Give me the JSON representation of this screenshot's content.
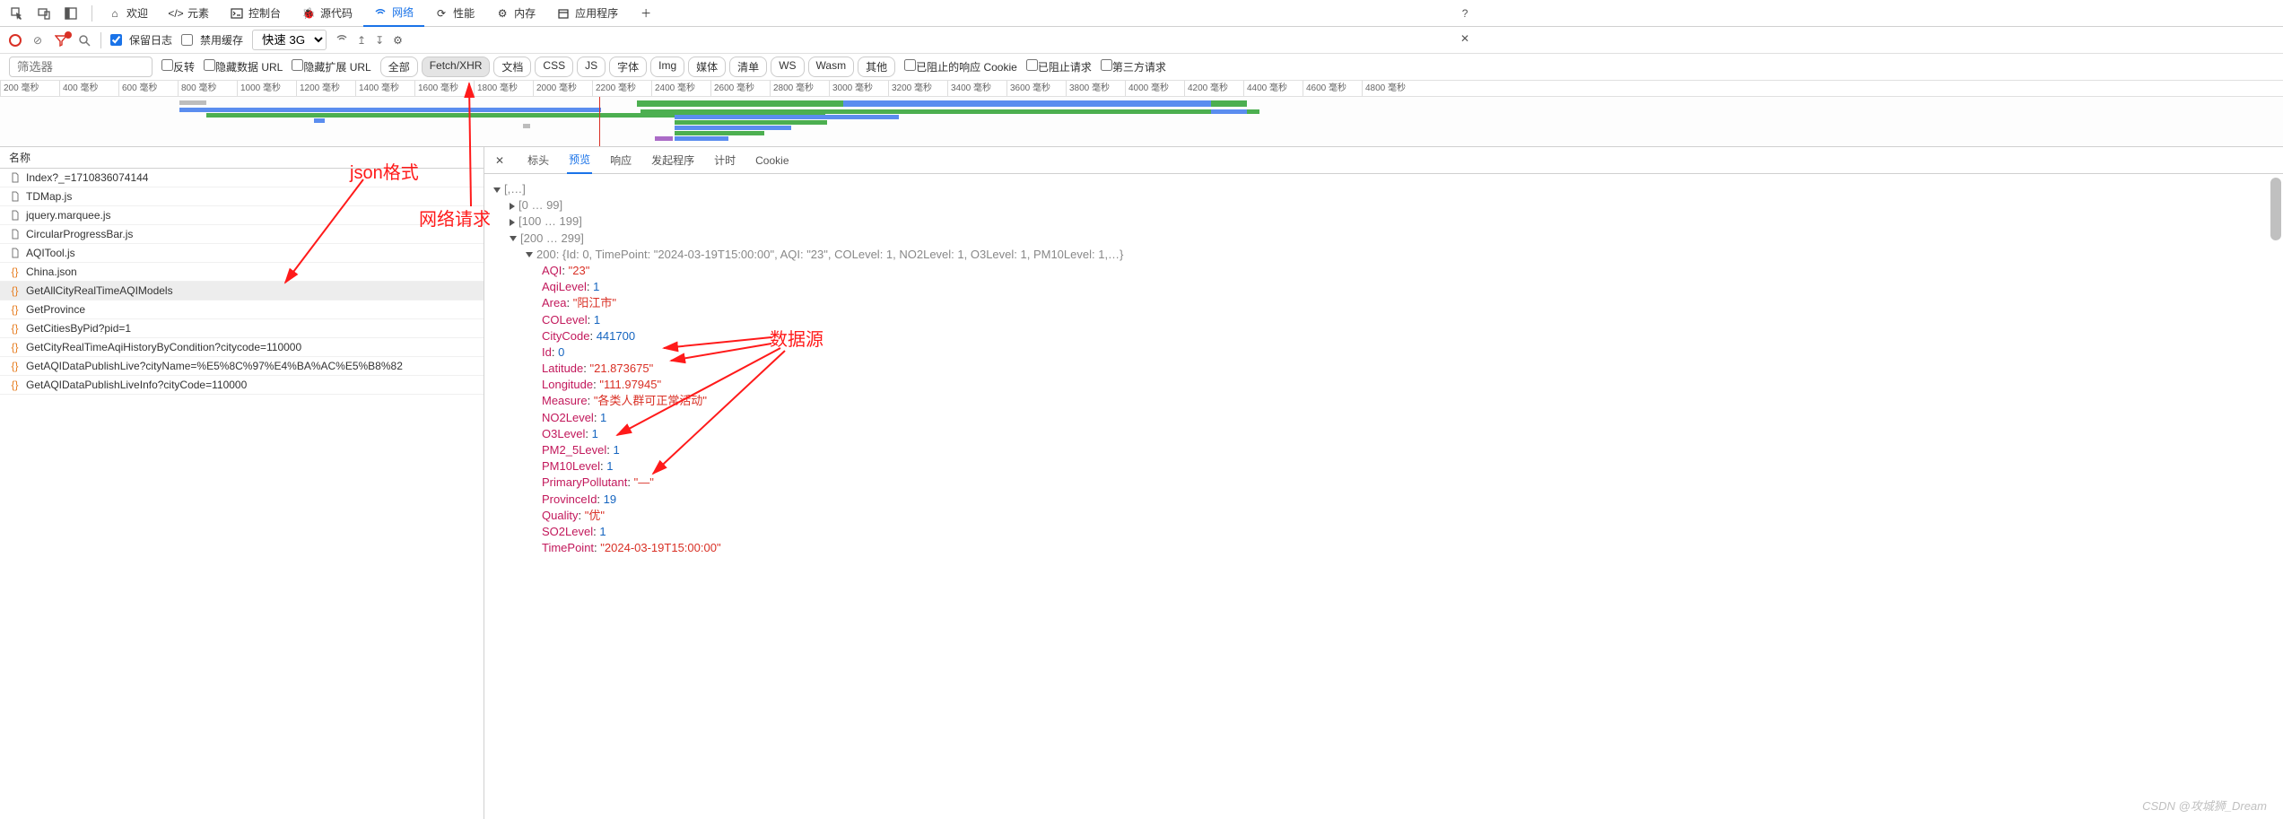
{
  "topTabs": {
    "welcome": "欢迎",
    "elements": "元素",
    "console": "控制台",
    "sources": "源代码",
    "network": "网络",
    "performance": "性能",
    "memory": "内存",
    "application": "应用程序"
  },
  "toolbar": {
    "preserve_log": "保留日志",
    "disable_cache": "禁用缓存",
    "throttle": "快速 3G"
  },
  "filter": {
    "placeholder": "筛选器",
    "invert": "反转",
    "hide_data_urls": "隐藏数据 URL",
    "hide_ext_urls": "隐藏扩展 URL",
    "chips": {
      "all": "全部",
      "fetch_xhr": "Fetch/XHR",
      "doc": "文档",
      "css": "CSS",
      "js": "JS",
      "font": "字体",
      "img": "Img",
      "media": "媒体",
      "manifest": "清单",
      "ws": "WS",
      "wasm": "Wasm",
      "other": "其他"
    },
    "blocked_cookies": "已阻止的响应 Cookie",
    "blocked_requests": "已阻止请求",
    "third_party": "第三方请求"
  },
  "ruler_ticks": [
    "200 毫秒",
    "400 毫秒",
    "600 毫秒",
    "800 毫秒",
    "1000 毫秒",
    "1200 毫秒",
    "1400 毫秒",
    "1600 毫秒",
    "1800 毫秒",
    "2000 毫秒",
    "2200 毫秒",
    "2400 毫秒",
    "2600 毫秒",
    "2800 毫秒",
    "3000 毫秒",
    "3200 毫秒",
    "3400 毫秒",
    "3600 毫秒",
    "3800 毫秒",
    "4000 毫秒",
    "4200 毫秒",
    "4400 毫秒",
    "4600 毫秒",
    "4800 毫秒"
  ],
  "column_header": "名称",
  "requests": [
    {
      "icon": "doc",
      "name": "Index?_=1710836074144"
    },
    {
      "icon": "doc",
      "name": "TDMap.js"
    },
    {
      "icon": "doc",
      "name": "jquery.marquee.js"
    },
    {
      "icon": "doc",
      "name": "CircularProgressBar.js"
    },
    {
      "icon": "doc",
      "name": "AQITool.js"
    },
    {
      "icon": "json",
      "name": "China.json"
    },
    {
      "icon": "json",
      "name": "GetAllCityRealTimeAQIModels",
      "selected": true
    },
    {
      "icon": "json",
      "name": "GetProvince"
    },
    {
      "icon": "json",
      "name": "GetCitiesByPid?pid=1"
    },
    {
      "icon": "json",
      "name": "GetCityRealTimeAqiHistoryByCondition?citycode=110000"
    },
    {
      "icon": "json",
      "name": "GetAQIDataPublishLive?cityName=%E5%8C%97%E4%BA%AC%E5%B8%82"
    },
    {
      "icon": "json",
      "name": "GetAQIDataPublishLiveInfo?cityCode=110000"
    }
  ],
  "detailTabs": {
    "headers": "标头",
    "preview": "预览",
    "response": "响应",
    "initiator": "发起程序",
    "timing": "计时",
    "cookies": "Cookie"
  },
  "preview": {
    "root": "[,…]",
    "r0": "[0 … 99]",
    "r1": "[100 … 199]",
    "r2": "[200 … 299]",
    "line200": "200: {Id: 0, TimePoint: \"2024-03-19T15:00:00\", AQI: \"23\", COLevel: 1, NO2Level: 1, O3Level: 1, PM10Level: 1,…}",
    "fields": [
      {
        "k": "AQI",
        "v": "\"23\"",
        "t": "s"
      },
      {
        "k": "AqiLevel",
        "v": "1",
        "t": "n"
      },
      {
        "k": "Area",
        "v": "\"阳江市\"",
        "t": "s"
      },
      {
        "k": "COLevel",
        "v": "1",
        "t": "n"
      },
      {
        "k": "CityCode",
        "v": "441700",
        "t": "n"
      },
      {
        "k": "Id",
        "v": "0",
        "t": "n"
      },
      {
        "k": "Latitude",
        "v": "\"21.873675\"",
        "t": "s"
      },
      {
        "k": "Longitude",
        "v": "\"111.97945\"",
        "t": "s"
      },
      {
        "k": "Measure",
        "v": "\"各类人群可正常活动\"",
        "t": "s"
      },
      {
        "k": "NO2Level",
        "v": "1",
        "t": "n"
      },
      {
        "k": "O3Level",
        "v": "1",
        "t": "n"
      },
      {
        "k": "PM2_5Level",
        "v": "1",
        "t": "n"
      },
      {
        "k": "PM10Level",
        "v": "1",
        "t": "n"
      },
      {
        "k": "PrimaryPollutant",
        "v": "\"—\"",
        "t": "s"
      },
      {
        "k": "ProvinceId",
        "v": "19",
        "t": "n"
      },
      {
        "k": "Quality",
        "v": "\"优\"",
        "t": "s"
      },
      {
        "k": "SO2Level",
        "v": "1",
        "t": "n"
      },
      {
        "k": "TimePoint",
        "v": "\"2024-03-19T15:00:00\"",
        "t": "s"
      }
    ]
  },
  "annotations": {
    "json_format": "json格式",
    "net_request": "网络请求",
    "data_source": "数据源"
  },
  "watermark": "CSDN @攻城狮_Dream"
}
